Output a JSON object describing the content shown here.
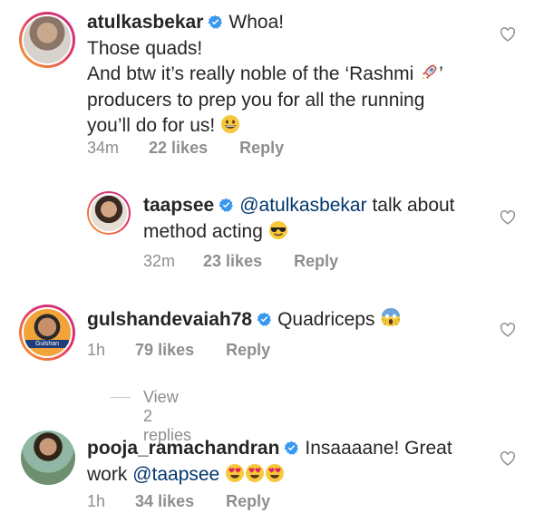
{
  "comments": [
    {
      "username": "atulkasbekar",
      "lines": [
        "Whoa!",
        "Those quads!",
        "And btw it’s really noble of the ‘Rashmi",
        "’",
        "producers to prep you for all the running",
        "you’ll do for us!"
      ],
      "time": "34m",
      "likes": "22 likes",
      "reply": "Reply"
    },
    {
      "username": "taapsee",
      "mention": "@atulkasbekar",
      "lines": [
        "talk about",
        "method acting"
      ],
      "time": "32m",
      "likes": "23 likes",
      "reply": "Reply"
    },
    {
      "username": "gulshandevaiah78",
      "lines": [
        "Quadriceps"
      ],
      "time": "1h",
      "likes": "79 likes",
      "reply": "Reply",
      "avatar_badge": "Gulshan",
      "view_replies": "View 2 replies"
    },
    {
      "username": "pooja_ramachandran",
      "lines": [
        "Insaaaane! Great",
        "work"
      ],
      "mention": "@taapsee",
      "time": "1h",
      "likes": "34 likes",
      "reply": "Reply"
    }
  ],
  "icons": {
    "verified": "verified-badge-icon",
    "like": "heart-outline-icon"
  },
  "colors": {
    "text": "#262626",
    "meta": "#8e8e8e",
    "mention": "#00376b",
    "verified": "#3897f0"
  }
}
